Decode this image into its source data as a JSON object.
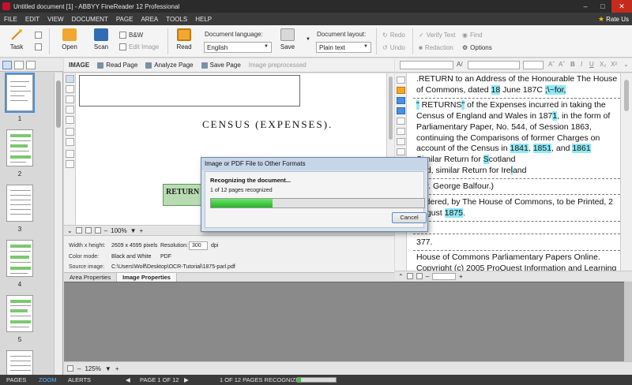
{
  "window": {
    "title": "Untitled document [1] - ABBYY FineReader 12 Professional"
  },
  "menu": {
    "items": [
      "FILE",
      "EDIT",
      "VIEW",
      "DOCUMENT",
      "PAGE",
      "AREA",
      "TOOLS",
      "HELP"
    ],
    "rate_us": "Rate Us"
  },
  "ribbon": {
    "task": "Task",
    "open": "Open",
    "scan": "Scan",
    "bw": "B&W",
    "edit_image": "Edit Image",
    "read": "Read",
    "doc_language_label": "Document language:",
    "doc_language_value": "English",
    "save": "Save",
    "doc_layout_label": "Document layout:",
    "doc_layout_value": "Plain text",
    "redo": "Redo",
    "undo": "Undo",
    "verify_text": "Verify Text",
    "redaction": "Redaction",
    "find": "Find",
    "options": "Options"
  },
  "pages_panel": {
    "page_numbers": [
      "1",
      "2",
      "3",
      "4",
      "5"
    ]
  },
  "image_toolbar": {
    "title": "IMAGE",
    "read_page": "Read Page",
    "analyze_page": "Analyze Page",
    "save_page": "Save Page",
    "preprocessed": "Image preprocessed"
  },
  "image": {
    "census_heading": "CENSUS (EXPENSES).",
    "returns_word": "RETURN"
  },
  "image_zoom": "100%",
  "properties": {
    "wh_label": "Width x height:",
    "wh_value": "2609 x 4595 pixels",
    "resolution_label": "Resolution:",
    "resolution_value": "300",
    "dpi": "dpi",
    "color_label": "Color mode:",
    "color_value": "Black and White",
    "format": "PDF",
    "source_label": "Source image:",
    "source_value": "C:\\Users\\Wolf\\Desktop\\OCR-Tutorial\\1875-parl.pdf",
    "tab_area": "Area Properties",
    "tab_image": "Image Properties"
  },
  "text": {
    "p1_a": ".RETURN to an Address of the Honourable The House",
    "p1_b": "of Commons, dated ",
    "p1_b_hl": "18",
    "p1_b_rest": " June 187C ",
    "p1_b_hl2": ";\\~for,",
    "p2_a_hl": "\"",
    "p2_a": " RETURNS",
    "p2_a_hl2": "\"",
    "p2_a_rest": " of the Expenses incurred in taking the",
    "p2_b": "Census of England and Wales in 187",
    "p2_b_hl": "1",
    "p2_b_rest": ", in the form of",
    "p2_c": "Parliamentary Paper, No. 544, of Session 1863,",
    "p2_d": "continuing the Comparisons of former Charges on",
    "p2_e": "account of the Census in ",
    "p2_e_hl1": "1841",
    "p2_e_sep1": ", ",
    "p2_e_hl2": "1851",
    "p2_e_sep2": ", and ",
    "p2_e_hl3": "1861",
    "p2_f": "Similar Return for ",
    "p2_f_hl": "S",
    "p2_f_rest": "cotland",
    "p2_g": "And, similar Return for Ire",
    "p2_g_hl": "l",
    "p2_g_rest": "and",
    "p3": "(Mr. George Balfour.)",
    "p4_a": "Ordered, by The House of Commons, to be Printed, 2",
    "p4_b": "August ",
    "p4_b_hl": "1875",
    "p4_b_rest": ".",
    "p5": "377.",
    "p6_a": "House of Commons Parliamentary Papers Online.",
    "p6_b": "Copyright (c) 2005 ProQuest Information and Learning"
  },
  "zoom_bottom": "125%",
  "statusbar": {
    "pages": "PAGES",
    "zoom": "ZOOM",
    "alerts": "ALERTS",
    "page_of": "PAGE 1 OF 12",
    "recognized": "1 OF 12 PAGES RECOGNIZED",
    "progress": 0.08
  },
  "dialog": {
    "title": "Image or PDF File to Other Formats",
    "message": "Recognizing the document...",
    "sub": "1 of 12 pages recognized",
    "progress": 0.29,
    "cancel": "Cancel"
  },
  "colors": {
    "highlight": "#8fe8f4",
    "progress": "#3cc43c",
    "accent": "#4a8fe0"
  }
}
